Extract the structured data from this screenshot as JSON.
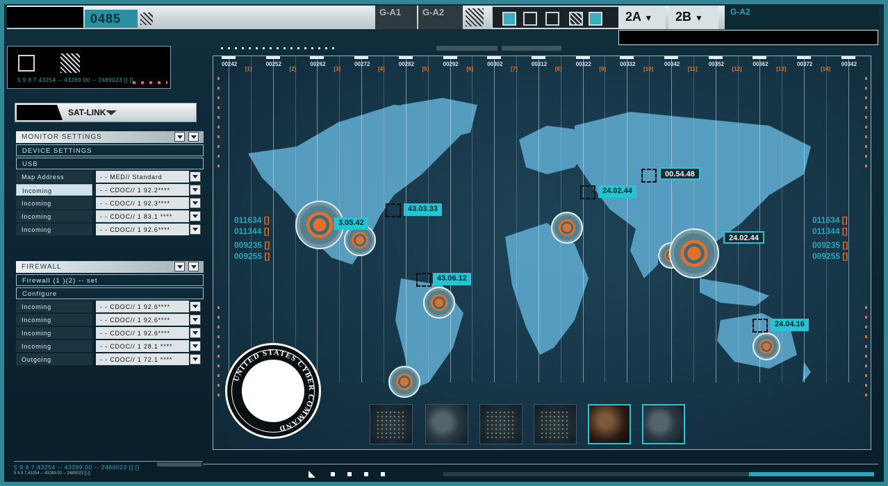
{
  "topbar": {
    "counter": "0485",
    "g_a1": "G-A1",
    "g_a2": "G-A2",
    "mode_2a": "2A",
    "mode_2b": "2B",
    "right_tag": "G-A2"
  },
  "coord_box": {
    "coords": "5 9 8 7.43254 -- 43289.00 -- 2489023 [] []"
  },
  "satlink": {
    "label": "SAT-LINK"
  },
  "monitor_panel": {
    "header": "MONITOR SETTINGS",
    "device_settings": "DEVICE SETTINGS",
    "usb": "USB",
    "rows": [
      {
        "key": "Map Address",
        "value": "- - MED// Standard",
        "selected": false
      },
      {
        "key": "Incoming",
        "value": "- - CDOC// 1 92.2****",
        "selected": true
      },
      {
        "key": "Incoming",
        "value": "- - CDOC// 1 92.3****",
        "selected": false
      },
      {
        "key": "Incoming",
        "value": "- - CDOC// 1 83.1 ****",
        "selected": false
      },
      {
        "key": "Incoming",
        "value": "- - CDOC// 1 92.6****",
        "selected": false
      }
    ]
  },
  "firewall_panel": {
    "header": "FIREWALL",
    "firewall_set": "Firewall (1 )(2) -- set",
    "configure": "Configure",
    "rows": [
      {
        "key": "Incoming",
        "value": "- - CDOC// 1 92.6****"
      },
      {
        "key": "Incoming",
        "value": "- - CDOC// 1 92.6****"
      },
      {
        "key": "Incoming",
        "value": "- - CDOC// 1 92.6****"
      },
      {
        "key": "Incoming",
        "value": "- - CDOC// 1 28.1 ****"
      },
      {
        "key": "Outgoing",
        "value": "- - CDOC// 1 72.1 ****"
      }
    ]
  },
  "bottom_left": {
    "coords": "5 9 8 7.43254 -- 43289.00 -- 2489023 [] []",
    "small": "5 9 8 7.43254 -- 43289.00 -- 2489023 [] []"
  },
  "map": {
    "ticks": [
      "00242",
      "00252",
      "00262",
      "00272",
      "00282",
      "00292",
      "00302",
      "00312",
      "00322",
      "00332",
      "00342",
      "00352",
      "00362",
      "00372",
      "00342"
    ],
    "sub_ticks": [
      "[1]",
      "[2]",
      "[3]",
      "[4]",
      "[5]",
      "[6]",
      "[7]",
      "[8]",
      "[9]",
      "[10]",
      "[11]",
      "[12]",
      "[13]",
      "[14]"
    ],
    "left_numbers": [
      "011634",
      "011344",
      "009235",
      "009255"
    ],
    "right_numbers": [
      "011634",
      "011344",
      "009235",
      "009255"
    ],
    "tags": [
      {
        "text": "3.05.42"
      },
      {
        "text": "43.03.33"
      },
      {
        "text": "43.06.12"
      },
      {
        "text": "24.02.44"
      },
      {
        "text": "00.54.48"
      },
      {
        "text": "24.02.44"
      },
      {
        "text": "24.04.16"
      }
    ],
    "seal_text": "UNITED STATES CYBER COMMAND"
  }
}
